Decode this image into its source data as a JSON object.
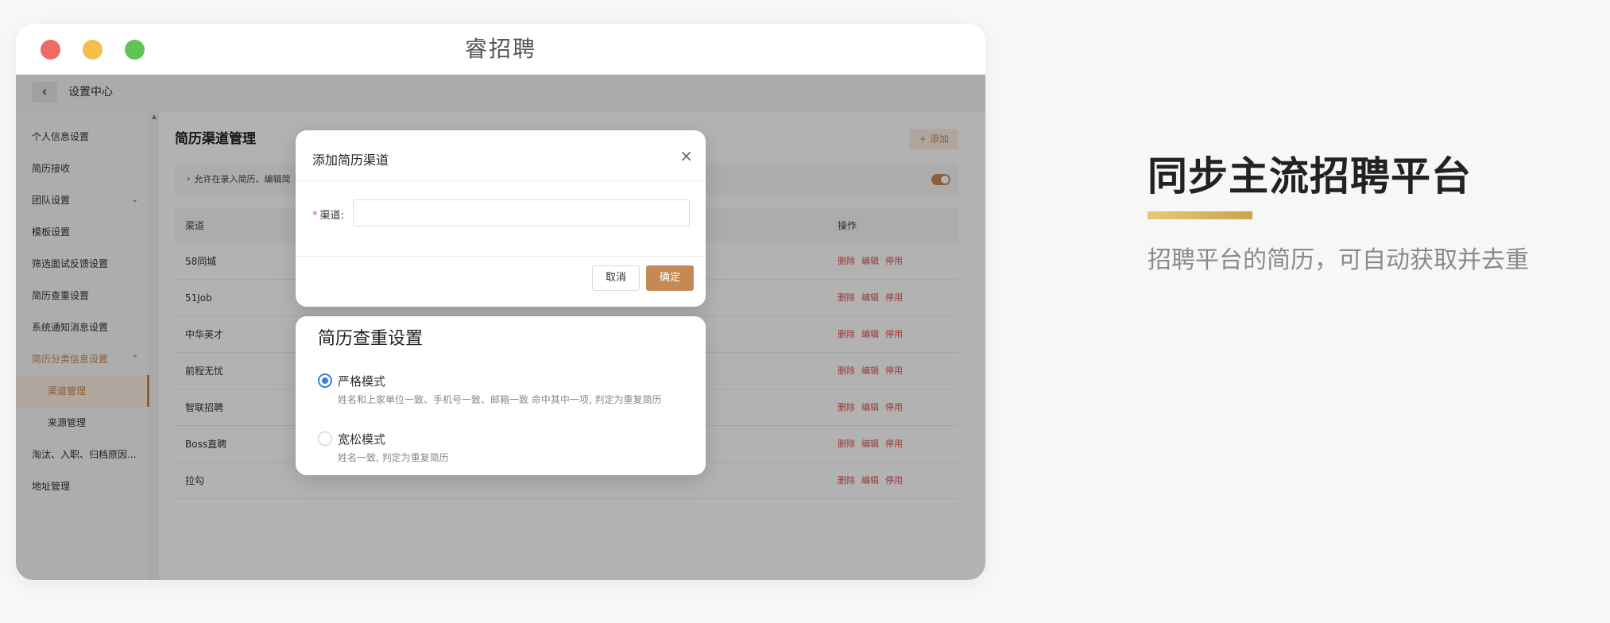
{
  "window": {
    "title": "睿招聘"
  },
  "topbar": {
    "back_icon": "‹",
    "title": "设置中心"
  },
  "sidebar": {
    "items": [
      {
        "label": "个人信息设置"
      },
      {
        "label": "简历接收"
      },
      {
        "label": "团队设置",
        "chevron": "⌄"
      },
      {
        "label": "模板设置"
      },
      {
        "label": "筛选面试反馈设置"
      },
      {
        "label": "简历查重设置"
      },
      {
        "label": "系统通知消息设置"
      },
      {
        "label": "简历分类信息设置",
        "chevron": "⌃"
      },
      {
        "label": "渠道管理"
      },
      {
        "label": "来源管理"
      },
      {
        "label": "淘汰、入职、归档原因..."
      },
      {
        "label": "地址管理"
      }
    ]
  },
  "main": {
    "title": "简历渠道管理",
    "add_label": "+ 添加",
    "notice": "允许在录入简历、编辑简",
    "table": {
      "headers": [
        "渠道",
        "操作"
      ],
      "rows": [
        "58同城",
        "51Job",
        "中华英才",
        "前程无忧",
        "智联招聘",
        "Boss直聘",
        "拉勾"
      ],
      "ops": [
        "删除",
        "编辑",
        "停用"
      ]
    }
  },
  "modal_add": {
    "title": "添加简历渠道",
    "close": "×",
    "field_label": "渠道:",
    "field_required": "*",
    "field_value": "",
    "cancel": "取消",
    "confirm": "确定"
  },
  "modal_dedup": {
    "title": "简历查重设置",
    "options": [
      {
        "title": "严格模式",
        "desc": "姓名和上家单位一致、手机号一致、邮箱一致 命中其中一项, 判定为重复简历",
        "selected": true
      },
      {
        "title": "宽松模式",
        "desc": "姓名一致, 判定为重复简历",
        "selected": false
      }
    ]
  },
  "promo": {
    "title": "同步主流招聘平台",
    "subtitle": "招聘平台的简历，可自动获取并去重"
  },
  "colors": {
    "accent": "#c48a55",
    "radio": "#3b7be8",
    "danger": "#d9534f"
  }
}
